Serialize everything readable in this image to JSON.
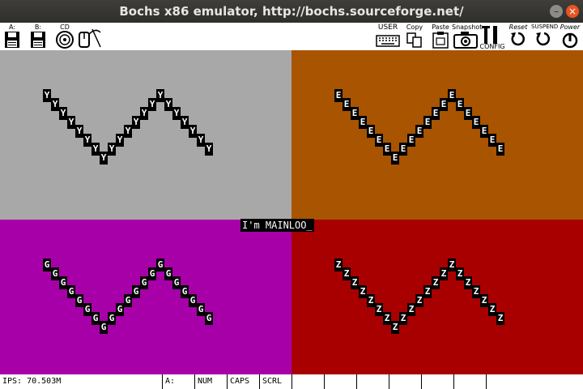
{
  "window": {
    "title": "Bochs x86 emulator, http://bochs.sourceforge.net/"
  },
  "toolbar": {
    "floppy_a": "A:",
    "floppy_b": "B:",
    "cdrom": "CD",
    "user": "USER",
    "copy": "Copy",
    "paste": "Paste",
    "snapshot": "Snapshot",
    "config": "CONFIG",
    "reset": "Reset",
    "suspend": "SUSPEND",
    "power": "Power"
  },
  "screen": {
    "message": "I'm MAINLOO_",
    "quadrants": [
      {
        "letter": "Y",
        "color": "#a8a8a8"
      },
      {
        "letter": "E",
        "color": "#a85400"
      },
      {
        "letter": "G",
        "color": "#a800a8"
      },
      {
        "letter": "Z",
        "color": "#a80000"
      }
    ]
  },
  "status": {
    "ips": "IPS: 70.503M",
    "drive": "A:",
    "num": "NUM",
    "caps": "CAPS",
    "scrl": "SCRL"
  }
}
